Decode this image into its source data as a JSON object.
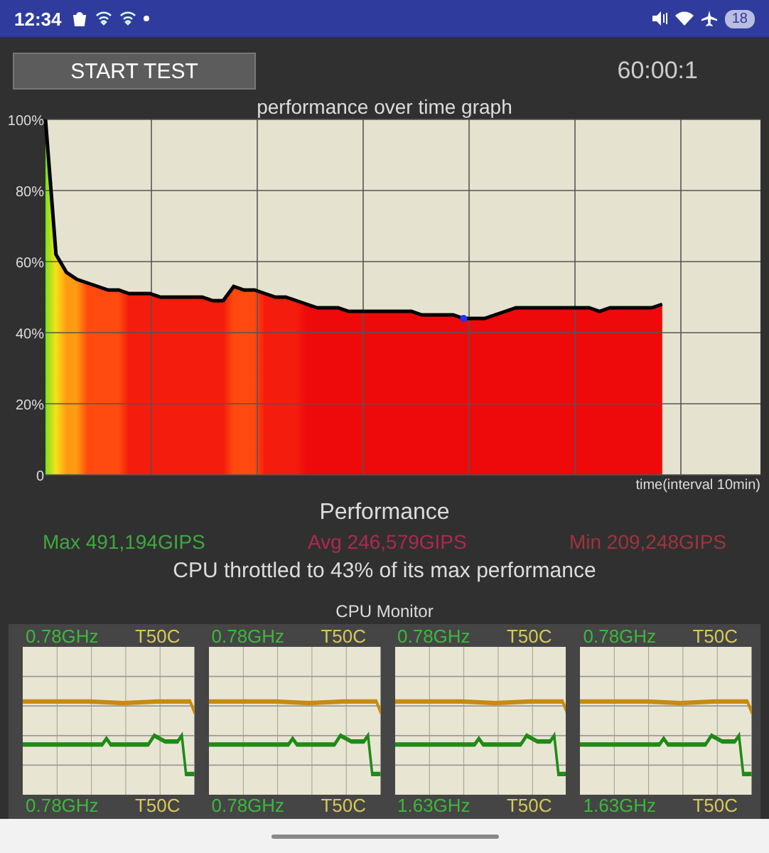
{
  "status_bar": {
    "time": "12:34",
    "battery": "18"
  },
  "toolbar": {
    "start_button": "START TEST",
    "timer": "60:00:1"
  },
  "graph": {
    "title": "performance over time graph",
    "chart_data": {
      "type": "area",
      "xlabel": "time(interval 10min)",
      "grid": true,
      "ylim": [
        0,
        100
      ],
      "yticks": [
        {
          "value": 0,
          "label": "0"
        },
        {
          "value": 20,
          "label": "20%"
        },
        {
          "value": 40,
          "label": "40%"
        },
        {
          "value": 60,
          "label": "60%"
        },
        {
          "value": 80,
          "label": "80%"
        },
        {
          "value": 100,
          "label": "100%"
        }
      ],
      "values": [
        100,
        62,
        57,
        55,
        54,
        53,
        52,
        52,
        51,
        51,
        51,
        50,
        50,
        50,
        50,
        50,
        49,
        49,
        53,
        52,
        52,
        51,
        50,
        50,
        49,
        48,
        47,
        47,
        47,
        46,
        46,
        46,
        46,
        46,
        46,
        46,
        45,
        45,
        45,
        45,
        44,
        44,
        44,
        45,
        46,
        47,
        47,
        47,
        47,
        47,
        47,
        47,
        47,
        46,
        47,
        47,
        47,
        47,
        47,
        48
      ]
    }
  },
  "performance": {
    "title": "Performance",
    "max": "Max 491,194GIPS",
    "avg": "Avg 246,579GIPS",
    "min": "Min 209,248GIPS",
    "summary": "CPU throttled to 43% of its max performance"
  },
  "cpu_monitor": {
    "title": "CPU Monitor",
    "cores": [
      {
        "kind": "with_graph",
        "freq": "0.78GHz",
        "temp": "T50C"
      },
      {
        "kind": "with_graph",
        "freq": "0.78GHz",
        "temp": "T50C"
      },
      {
        "kind": "with_graph",
        "freq": "0.78GHz",
        "temp": "T50C"
      },
      {
        "kind": "with_graph",
        "freq": "0.78GHz",
        "temp": "T50C"
      },
      {
        "kind": "label_only",
        "freq": "0.78GHz",
        "temp": "T50C"
      },
      {
        "kind": "label_only",
        "freq": "0.78GHz",
        "temp": "T50C"
      },
      {
        "kind": "label_only",
        "freq": "1.63GHz",
        "temp": "T50C"
      },
      {
        "kind": "label_only",
        "freq": "1.63GHz",
        "temp": "T50C"
      }
    ]
  }
}
